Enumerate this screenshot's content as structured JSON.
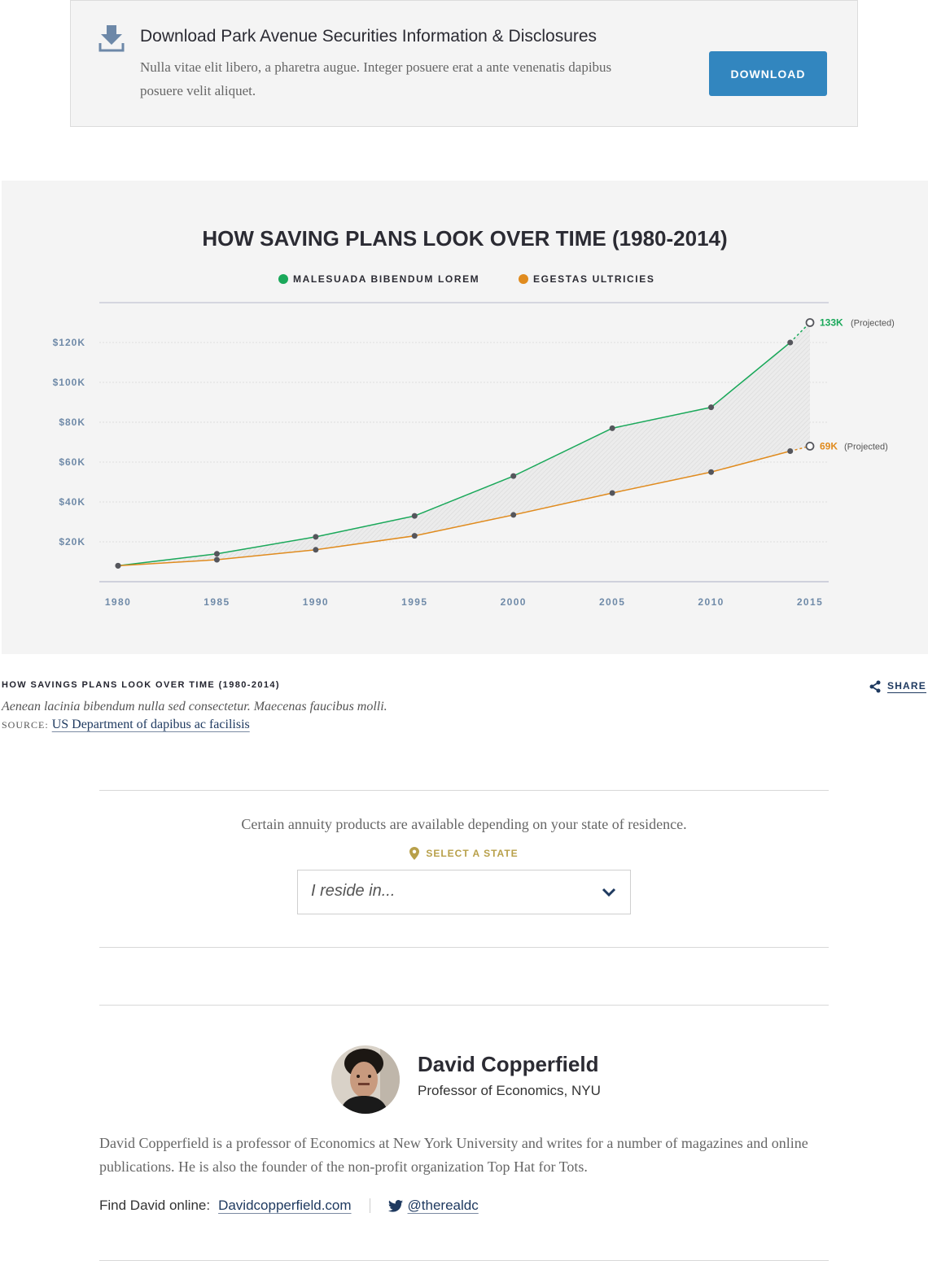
{
  "download": {
    "title": "Download Park Avenue Securities Information & Disclosures",
    "description": "Nulla vitae elit libero, a pharetra augue. Integer posuere erat a ante venenatis dapibus posuere velit aliquet.",
    "button_label": "DOWNLOAD",
    "icon": "download-icon"
  },
  "chart_data": {
    "type": "line",
    "title": "HOW SAVING PLANS LOOK OVER TIME (1980-2014)",
    "x_ticks": [
      "1980",
      "1985",
      "1990",
      "1995",
      "2000",
      "2005",
      "2010",
      "2015"
    ],
    "y_ticks": [
      "$20K",
      "$40K",
      "$60K",
      "$80K",
      "$100K",
      "$120K"
    ],
    "xlim": [
      1980,
      2015
    ],
    "ylim": [
      0,
      140
    ],
    "grid": true,
    "legend_position": "top",
    "series": [
      {
        "name": "MALESUADA BIBENDUM LOREM",
        "color": "#1aa85a",
        "x": [
          1980,
          1985,
          1990,
          1995,
          2000,
          2005,
          2010,
          2014
        ],
        "y": [
          8,
          14,
          22.5,
          33,
          53,
          77,
          87.5,
          120
        ],
        "projected": {
          "x": 2015,
          "y": 130,
          "label": "133K",
          "note": "(Projected)"
        }
      },
      {
        "name": "EGESTAS ULTRICIES",
        "color": "#e08b1e",
        "x": [
          1980,
          1985,
          1990,
          1995,
          2000,
          2005,
          2010,
          2014
        ],
        "y": [
          8,
          11,
          16,
          23,
          33.5,
          44.5,
          55,
          65.5
        ],
        "projected": {
          "x": 2015,
          "y": 68,
          "label": "69K",
          "note": "(Projected)"
        }
      }
    ]
  },
  "caption": {
    "title": "HOW SAVINGS PLANS LOOK OVER TIME (1980-2014)",
    "description": "Aenean lacinia bibendum nulla sed consectetur. Maecenas faucibus molli.",
    "source_label": "SOURCE:",
    "source_link": "US Department of dapibus ac facilisis",
    "share_label": "SHARE"
  },
  "state": {
    "note": "Certain annuity products are available depending on your state of residence.",
    "label": "SELECT A STATE",
    "placeholder": "I reside in..."
  },
  "author": {
    "name": "David Copperfield",
    "role": "Professor of Economics, NYU",
    "bio": "David Copperfield is a professor of Economics at New York University and writes for a number of magazines and online publications. He is also the founder of the non-profit organization Top Hat for Tots.",
    "find_label": "Find David online:",
    "website": "Davidcopperfield.com",
    "twitter": "@therealdc"
  }
}
